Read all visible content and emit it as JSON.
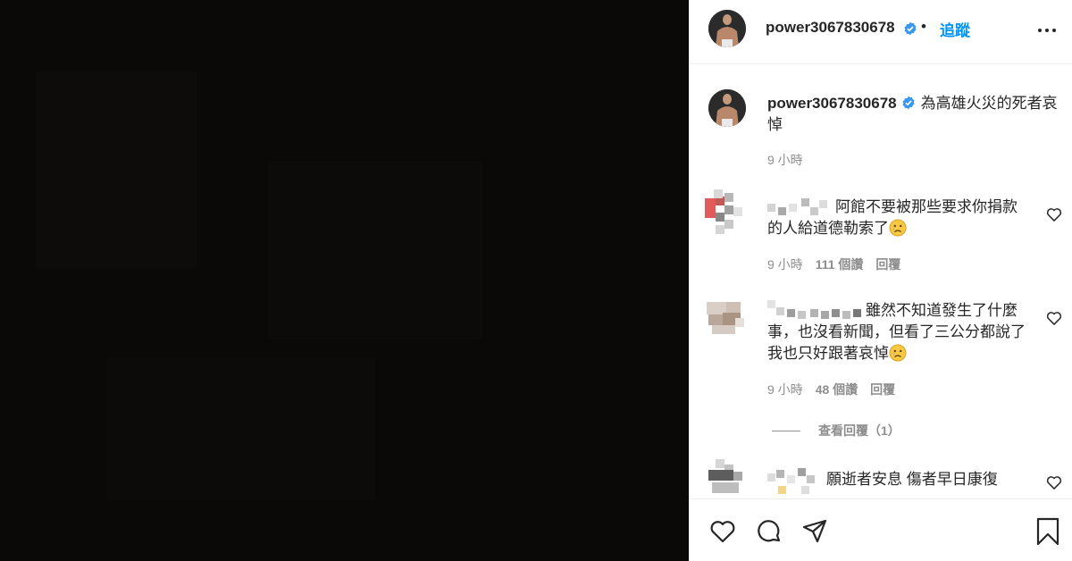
{
  "post": {
    "author": "power3067830678",
    "follow_label": "追蹤",
    "separator": "•",
    "caption": "為高雄火災的死者哀悼",
    "time": "9 小時"
  },
  "comments": [
    {
      "text": "阿館不要被那些要求你捐款的人給道德勒索了",
      "time": "9 小時",
      "likes": "111 個讚",
      "reply": "回覆"
    },
    {
      "text": "雖然不知道發生了什麼事，也沒看新聞，但看了三公分都說了我也只好跟著哀悼",
      "time": "9 小時",
      "likes": "48 個讚",
      "reply": "回覆",
      "view_replies": "查看回覆（1）"
    },
    {
      "text": "願逝者安息 傷者早日康復"
    }
  ],
  "colors": {
    "accent": "#0095f6",
    "verified": "#3897f0",
    "muted": "#8e8e8e",
    "media_bg": "#0b0908"
  },
  "icons": [
    "verified-badge-icon",
    "more-options-icon",
    "heart-icon",
    "comment-icon",
    "share-icon",
    "bookmark-icon",
    "crying-face-emoji"
  ]
}
